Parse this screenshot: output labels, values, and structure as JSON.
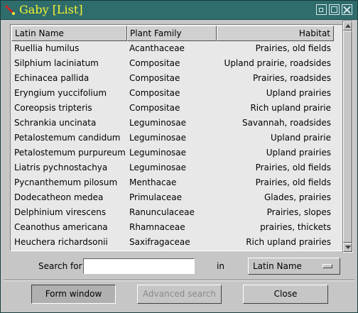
{
  "window": {
    "title": "Gaby [List]"
  },
  "table": {
    "columns": [
      "Latin Name",
      "Plant Family",
      "Habitat"
    ],
    "rows": [
      [
        "Ruellia humilus",
        "Acanthaceae",
        "Prairies, old fields"
      ],
      [
        "Silphium laciniatum",
        "Compositae",
        "Upland prairie, roadsides"
      ],
      [
        "Echinacea pallida",
        "Compositae",
        "Prairies, roadsides"
      ],
      [
        "Eryngium yuccifolium",
        "Compositae",
        "Upland prairies"
      ],
      [
        "Coreopsis tripteris",
        "Compositae",
        "Rich upland prairie"
      ],
      [
        "Schrankia uncinata",
        "Leguminosae",
        "Savannah, roadsides"
      ],
      [
        "Petalostemum candidum",
        "Leguminosae",
        "Upland prairie"
      ],
      [
        "Petalostemum purpureum",
        "Leguminosae",
        "Upland prairies"
      ],
      [
        "Liatris pychnostachya",
        "Leguminosae",
        "Prairies, old fields"
      ],
      [
        "Pycnanthemum pilosum",
        "Menthacae",
        "Prairies, old fields"
      ],
      [
        "Dodecatheon medea",
        "Primulaceae",
        "Glades, prairies"
      ],
      [
        "Delphinium virescens",
        "Ranunculaceae",
        "Prairies, slopes"
      ],
      [
        "Ceanothus americana",
        "Rhamnaceae",
        "prairies, thickets"
      ],
      [
        "Heuchera richardsonii",
        "Saxifragaceae",
        "Rich upland prairies"
      ]
    ]
  },
  "search": {
    "label": "Search for",
    "value": "",
    "in_label": "in",
    "field_selected": "Latin Name"
  },
  "buttons": {
    "form_window": "Form window",
    "advanced_search": "Advanced search",
    "close": "Close"
  }
}
